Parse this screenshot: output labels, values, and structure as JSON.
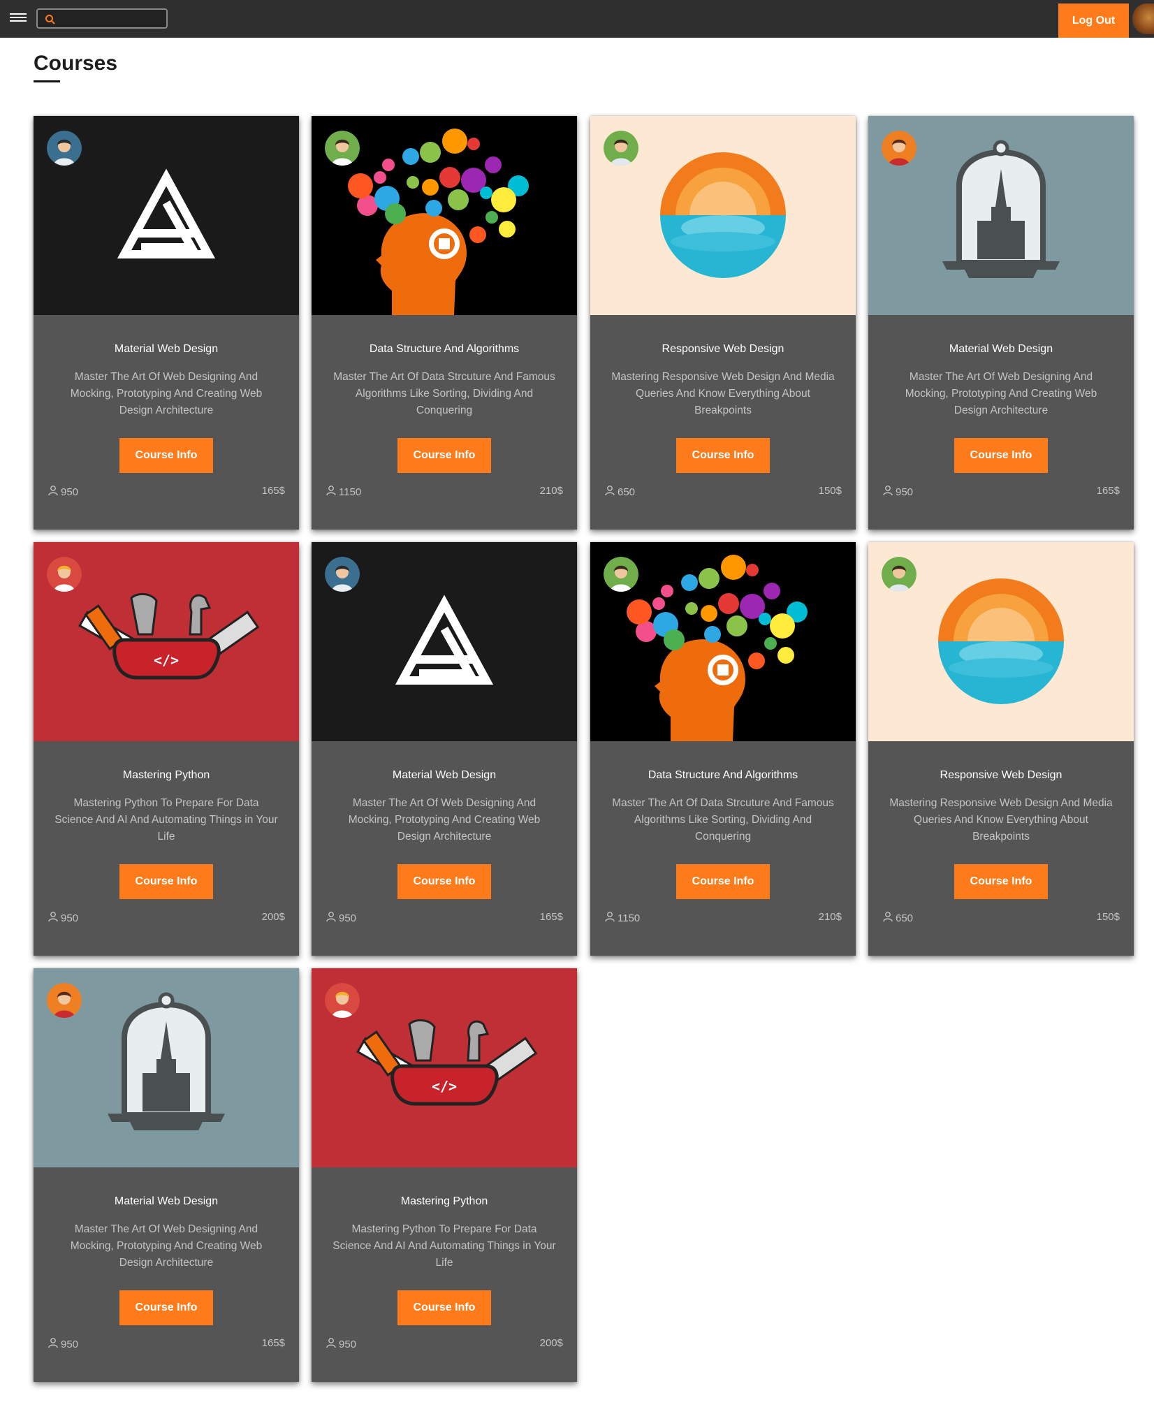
{
  "header": {
    "menu_icon": "hamburger-menu-icon",
    "search": {
      "icon": "search-icon",
      "value": "",
      "placeholder": ""
    },
    "logout_label": "Log Out",
    "accent_color": "#fd7b1a"
  },
  "page": {
    "title": "Courses"
  },
  "courses": [
    {
      "title": "Material Web Design",
      "description": "Master The Art Of Web Designing And Mocking, Prototyping And Creating Web Design Architecture",
      "button_label": "Course Info",
      "students": "950",
      "price": "165$",
      "image": "triangle-logo",
      "avatar": "blue-man"
    },
    {
      "title": "Data Structure And Algorithms",
      "description": "Master The Art Of Data Strcuture And Famous Algorithms Like Sorting, Dividing And Conquering",
      "button_label": "Course Info",
      "students": "1150",
      "price": "210$",
      "image": "head-ideas",
      "avatar": "green-woman"
    },
    {
      "title": "Responsive Web Design",
      "description": "Mastering Responsive Web Design And Media Queries And Know Everything About Breakpoints",
      "button_label": "Course Info",
      "students": "650",
      "price": "150$",
      "image": "sunset",
      "avatar": "green-man"
    },
    {
      "title": "Material Web Design",
      "description": "Master The Art Of Web Designing And Mocking, Prototyping And Creating Web Design Architecture",
      "button_label": "Course Info",
      "students": "950",
      "price": "165$",
      "image": "bell-jar",
      "avatar": "orange-woman"
    },
    {
      "title": "Mastering Python",
      "description": "Mastering Python To Prepare For Data Science And AI And Automating Things in Your Life",
      "button_label": "Course Info",
      "students": "950",
      "price": "200$",
      "image": "swiss-knife",
      "avatar": "red-woman"
    },
    {
      "title": "Material Web Design",
      "description": "Master The Art Of Web Designing And Mocking, Prototyping And Creating Web Design Architecture",
      "button_label": "Course Info",
      "students": "950",
      "price": "165$",
      "image": "triangle-logo",
      "avatar": "blue-man"
    },
    {
      "title": "Data Structure And Algorithms",
      "description": "Master The Art Of Data Strcuture And Famous Algorithms Like Sorting, Dividing And Conquering",
      "button_label": "Course Info",
      "students": "1150",
      "price": "210$",
      "image": "head-ideas",
      "avatar": "green-woman"
    },
    {
      "title": "Responsive Web Design",
      "description": "Mastering Responsive Web Design And Media Queries And Know Everything About Breakpoints",
      "button_label": "Course Info",
      "students": "650",
      "price": "150$",
      "image": "sunset",
      "avatar": "green-man"
    },
    {
      "title": "Material Web Design",
      "description": "Master The Art Of Web Designing And Mocking, Prototyping And Creating Web Design Architecture",
      "button_label": "Course Info",
      "students": "950",
      "price": "165$",
      "image": "bell-jar",
      "avatar": "orange-woman"
    },
    {
      "title": "Mastering Python",
      "description": "Mastering Python To Prepare For Data Science And AI And Automating Things in Your Life",
      "button_label": "Course Info",
      "students": "950",
      "price": "200$",
      "image": "swiss-knife",
      "avatar": "red-woman"
    }
  ]
}
